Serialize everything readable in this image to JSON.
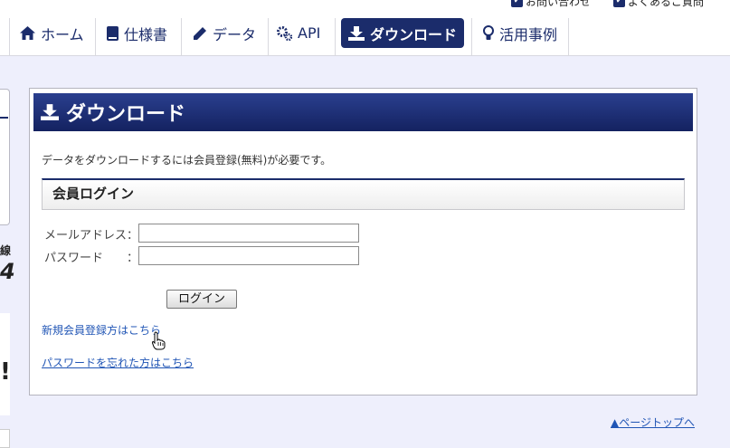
{
  "top_links": {
    "contact": "お問い合わせ",
    "faq": "よくあるご質問"
  },
  "nav": {
    "items": [
      {
        "label": "ホーム",
        "icon": "home-icon"
      },
      {
        "label": "仕様書",
        "icon": "book-icon"
      },
      {
        "label": "データ",
        "icon": "pencil-icon"
      },
      {
        "label": "API",
        "icon": "gears-icon"
      },
      {
        "label": "ダウンロード",
        "icon": "download-icon",
        "active": true
      },
      {
        "label": "活用事例",
        "icon": "lightbulb-icon"
      }
    ]
  },
  "left_fragment": {
    "text1": "線",
    "text2": "4",
    "text3": "!"
  },
  "panel": {
    "title": "ダウンロード",
    "description": "データをダウンロードするには会員登録(無料)が必要です。",
    "section_title": "会員ログイン",
    "email_label": "メールアドレス",
    "password_label": "パスワード",
    "colon": "：",
    "email_value": "",
    "password_value": "",
    "login_button": "ログイン",
    "register_link": "新規会員登録方はこちら",
    "forgot_link": "パスワードを忘れた方はこちら"
  },
  "footer": {
    "page_top": "▲ページトップへ"
  },
  "colors": {
    "navy": "#1b2c6b",
    "page_bg": "#eeeffc",
    "link": "#2055b5"
  }
}
